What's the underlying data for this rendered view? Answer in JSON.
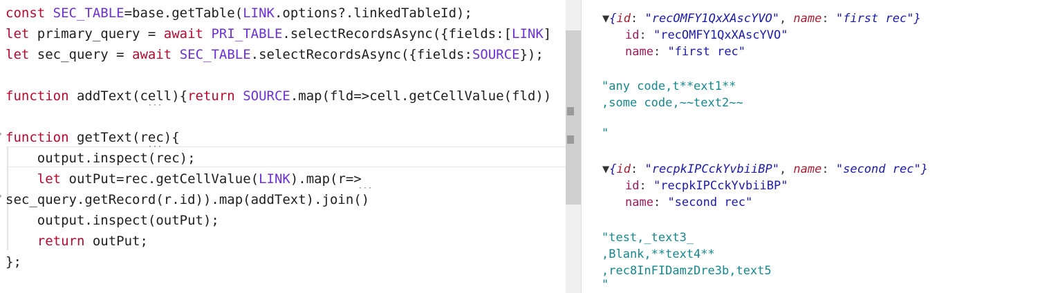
{
  "editor": {
    "lines": [
      {
        "tokens": [
          {
            "t": "const ",
            "c": "kw"
          },
          {
            "t": "SEC_TABLE",
            "c": "cst"
          },
          {
            "t": "=base.getTable(",
            "c": "idn"
          },
          {
            "t": "LINK",
            "c": "cst"
          },
          {
            "t": ".options?.linkedTableId);",
            "c": "idn"
          }
        ]
      },
      {
        "tokens": [
          {
            "t": "let ",
            "c": "kw"
          },
          {
            "t": "primary_query = ",
            "c": "idn"
          },
          {
            "t": "await ",
            "c": "kw"
          },
          {
            "t": "PRI_TABLE",
            "c": "cst"
          },
          {
            "t": ".selectRecordsAsync({fields:[",
            "c": "idn"
          },
          {
            "t": "LINK",
            "c": "cst"
          },
          {
            "t": "]",
            "c": "idn"
          }
        ]
      },
      {
        "tokens": [
          {
            "t": "let ",
            "c": "kw"
          },
          {
            "t": "sec_query = ",
            "c": "idn"
          },
          {
            "t": "await ",
            "c": "kw"
          },
          {
            "t": "SEC_TABLE",
            "c": "cst"
          },
          {
            "t": ".selectRecordsAsync({fields:",
            "c": "idn"
          },
          {
            "t": "SOURCE",
            "c": "cst"
          },
          {
            "t": "});",
            "c": "idn"
          }
        ]
      },
      {
        "tokens": []
      },
      {
        "tokens": [
          {
            "t": "function ",
            "c": "kw"
          },
          {
            "t": "addText(cell){",
            "c": "idn"
          },
          {
            "t": "return ",
            "c": "kw"
          },
          {
            "t": "SOURCE",
            "c": "cst"
          },
          {
            "t": ".map(fld=>cell.getCellValue(fld))",
            "c": "idn"
          }
        ]
      },
      {
        "tokens": []
      },
      {
        "tokens": [
          {
            "t": "function ",
            "c": "kw"
          },
          {
            "t": "getText(rec){",
            "c": "idn"
          }
        ]
      },
      {
        "tokens": [
          {
            "t": "    output.inspect(rec);",
            "c": "idn"
          }
        ]
      },
      {
        "tokens": [
          {
            "t": "    ",
            "c": "idn"
          },
          {
            "t": "let ",
            "c": "kw"
          },
          {
            "t": "outPut=rec.getCellValue(",
            "c": "idn"
          },
          {
            "t": "LINK",
            "c": "cst"
          },
          {
            "t": ").map(r=>",
            "c": "idn"
          }
        ]
      },
      {
        "tokens": [
          {
            "t": "sec_query.getRecord(r.id)).map(addText).join()",
            "c": "idn"
          }
        ]
      },
      {
        "tokens": [
          {
            "t": "    output.inspect(outPut);",
            "c": "idn"
          }
        ]
      },
      {
        "tokens": [
          {
            "t": "    ",
            "c": "idn"
          },
          {
            "t": "return ",
            "c": "kw"
          },
          {
            "t": "outPut;",
            "c": "idn"
          }
        ]
      },
      {
        "tokens": [
          {
            "t": "};",
            "c": "idn"
          }
        ]
      }
    ]
  },
  "console": {
    "records": [
      {
        "toggle": "▼",
        "summary_open": "{",
        "summary_id_key": "id",
        "summary_id_val": "\"recOMFY1QxXAscYVO\"",
        "summary_name_key": "name",
        "summary_name_val": "\"first rec\"",
        "summary_close": "}",
        "id_key": "id",
        "id_val": "\"recOMFY1QxXAscYVO\"",
        "name_key": "name",
        "name_val": "\"first rec\"",
        "output_lines": [
          "\"any code,t**ext1**",
          ",some code,~~text2~~",
          "",
          "\""
        ]
      },
      {
        "toggle": "▼",
        "summary_open": "{",
        "summary_id_key": "id",
        "summary_id_val": "\"recpkIPCckYvbiiBP\"",
        "summary_name_key": "name",
        "summary_name_val": "\"second rec\"",
        "summary_close": "}",
        "id_key": "id",
        "id_val": "\"recpkIPCckYvbiiBP\"",
        "name_key": "name",
        "name_val": "\"second rec\"",
        "output_lines": [
          "\"test,_text3_",
          ",Blank,**text4**",
          ",rec8InFIDamzDre3b,text5",
          "\""
        ]
      }
    ]
  }
}
